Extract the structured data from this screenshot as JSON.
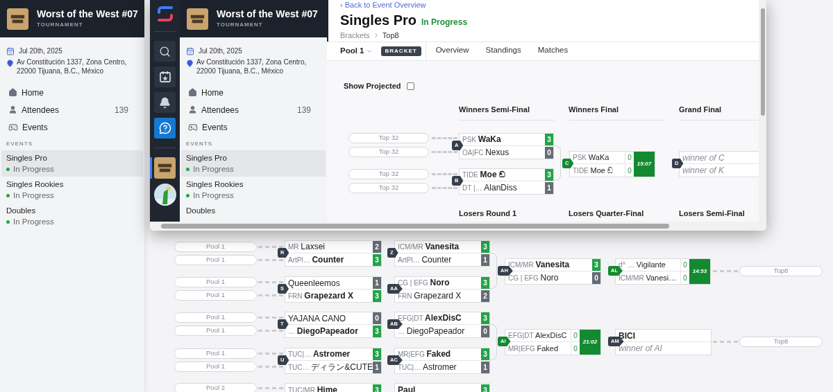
{
  "background": {
    "sidebar": {
      "title": "Worst of the West #07",
      "subtitle": "TOURNAMENT",
      "date": "Jul 20th, 2025",
      "address": "Av Constitución 1337, Zona Centro, 22000 Tijuana, B.C., México",
      "nav": [
        {
          "kind": "home",
          "label": "Home"
        },
        {
          "kind": "attendees",
          "label": "Attendees",
          "count": "139"
        },
        {
          "kind": "events",
          "label": "Events"
        }
      ],
      "events_heading": "EVENTS",
      "events": [
        {
          "name": "Singles Pro",
          "status": "In Progress",
          "selected": true
        },
        {
          "name": "Singles Rookies",
          "status": "In Progress",
          "selected": false
        },
        {
          "name": "Doubles",
          "status": "In Progress",
          "selected": false
        }
      ]
    },
    "bracket": {
      "entrants": [
        {
          "label": "Pool 1"
        },
        {
          "label": "Pool 1"
        },
        {
          "label": "Pool 1"
        },
        {
          "label": "Pool 1"
        },
        {
          "label": "Pool 1"
        },
        {
          "label": "Pool 1"
        },
        {
          "label": "Pool 1"
        },
        {
          "label": "Pool 1"
        },
        {
          "label": "Pool 2"
        }
      ],
      "matches": [
        {
          "label": "R",
          "kind": "done",
          "players": [
            {
              "prefix": "MR",
              "name": "Laxsei",
              "score": "2",
              "winner": false
            },
            {
              "prefix": "ArtPl…",
              "name": "Counter",
              "score": "3",
              "winner": true
            }
          ]
        },
        {
          "label": "S",
          "kind": "done",
          "players": [
            {
              "name": "Queenleemos",
              "score": "1",
              "winner": false
            },
            {
              "prefix": "FRN",
              "name": "Grapezard X",
              "score": "3",
              "winner": true
            }
          ]
        },
        {
          "label": "T",
          "kind": "done",
          "players": [
            {
              "name": "YAJANA CANO",
              "score": "0",
              "winner": false
            },
            {
              "prefix": "…",
              "name": "DiegoPapeador",
              "score": "3",
              "winner": true
            }
          ]
        },
        {
          "label": "U",
          "kind": "done",
          "players": [
            {
              "prefix": "TUC|…",
              "name": "Astromer",
              "score": "3",
              "winner": true
            },
            {
              "prefix": "TUC…",
              "name": "ディラン&CUTE",
              "score": "1",
              "winner": false
            }
          ]
        },
        {
          "kind": "done",
          "players": [
            {
              "prefix": "TUC/MR",
              "name": "Hime",
              "score": "3",
              "winner": true
            }
          ]
        },
        {
          "label": "Z",
          "kind": "done",
          "players": [
            {
              "prefix": "ICM/MR",
              "name": "Vanesita",
              "score": "3",
              "winner": true
            },
            {
              "prefix": "ArtPl…",
              "name": "Counter",
              "score": "1",
              "winner": false
            }
          ]
        },
        {
          "label": "AA",
          "kind": "done",
          "players": [
            {
              "prefix": "CG | EFG",
              "name": "Noro",
              "score": "3",
              "winner": true
            },
            {
              "prefix": "FRN",
              "name": "Grapezard X",
              "score": "2",
              "winner": false
            }
          ]
        },
        {
          "label": "AB",
          "kind": "done",
          "players": [
            {
              "prefix": "EFG|DT",
              "name": "AlexDisC",
              "score": "3",
              "winner": true
            },
            {
              "prefix": "…",
              "name": "DiegoPapeador",
              "score": "0",
              "winner": false
            }
          ]
        },
        {
          "label": "AC",
          "kind": "done",
          "players": [
            {
              "prefix": "MR|EFG",
              "name": "Faked",
              "score": "3",
              "winner": true
            },
            {
              "prefix": "TUC|…",
              "name": "Astromer",
              "score": "1",
              "winner": false
            }
          ]
        },
        {
          "kind": "done",
          "players": [
            {
              "name": "Paul",
              "score": "3",
              "winner": true
            }
          ]
        },
        {
          "label": "AH",
          "kind": "done",
          "players": [
            {
              "prefix": "ICM/MR",
              "name": "Vanesita",
              "score": "3",
              "winner": true
            },
            {
              "prefix": "CG | EFG",
              "name": "Noro",
              "score": "0",
              "winner": false
            }
          ]
        },
        {
          "label": "AI",
          "kind": "live",
          "timer": "21:02",
          "players": [
            {
              "prefix": "EFG|DT",
              "name": "AlexDisC",
              "score": "0",
              "winner": false
            },
            {
              "prefix": "MR|EFG",
              "name": "Faked",
              "score": "0",
              "winner": false
            }
          ]
        },
        {
          "label": "AL",
          "kind": "live",
          "timer": "14:53",
          "players": [
            {
              "prefix": "d^ …",
              "name": "Vigilante",
              "score": "0",
              "winner": false
            },
            {
              "prefix": "ICM/MR",
              "name": "Vanesi…",
              "score": "0",
              "winner": false
            }
          ]
        },
        {
          "label": "AM",
          "kind": "pending",
          "players": [
            {
              "name": "BICI",
              "tbd": false
            },
            {
              "name": "winner of AI",
              "tbd": true
            }
          ]
        }
      ],
      "outputs": [
        {
          "label": "Top8"
        },
        {
          "label": "Top8"
        }
      ]
    }
  },
  "window": {
    "rail": [
      {
        "kind": "search",
        "selected": false
      },
      {
        "kind": "calendar",
        "selected": false
      },
      {
        "kind": "bell",
        "selected": false
      },
      {
        "kind": "help",
        "selected": false
      },
      {
        "kind": "tournament",
        "selected": true
      }
    ],
    "sidebar": {
      "title": "Worst of the West #07",
      "subtitle": "TOURNAMENT",
      "date": "Jul 20th, 2025",
      "address": "Av Constitución 1337, Zona Centro, 22000 Tijuana, B.C., México",
      "nav": [
        {
          "kind": "home",
          "label": "Home"
        },
        {
          "kind": "attendees",
          "label": "Attendees",
          "count": "139"
        },
        {
          "kind": "events",
          "label": "Events"
        }
      ],
      "events_heading": "EVENTS",
      "events": [
        {
          "name": "Singles Pro",
          "status": "In Progress",
          "selected": true
        },
        {
          "name": "Singles Rookies",
          "status": "In Progress",
          "selected": false
        },
        {
          "name": "Doubles",
          "selected": false
        }
      ]
    },
    "main": {
      "back_link": "‹ Back to Event Overview",
      "title": "Singles Pro",
      "status": "In Progress",
      "breadcrumb": [
        "Brackets",
        "Top8"
      ],
      "pool": "Pool 1",
      "badge": "BRACKET",
      "tabs": [
        {
          "label": "Overview",
          "selected": false
        },
        {
          "label": "Standings",
          "selected": false
        },
        {
          "label": "Matches",
          "selected": false
        }
      ],
      "show_projected": {
        "label": "Show Projected",
        "checked": false
      },
      "rounds": [
        {
          "title": "Winners Semi-Final"
        },
        {
          "title": "Winners Final"
        },
        {
          "title": "Grand Final"
        },
        {
          "title": "Losers Round 1"
        },
        {
          "title": "Losers Quarter-Final"
        },
        {
          "title": "Losers Semi-Final"
        }
      ],
      "entrants": [
        {
          "label": "Top 32"
        },
        {
          "label": "Top 32"
        },
        {
          "label": "Top 32"
        },
        {
          "label": "Top 32"
        }
      ],
      "matches": [
        {
          "label": "A",
          "kind": "done",
          "players": [
            {
              "prefix": "PSK",
              "name": "WaKa",
              "score": "3",
              "winner": true
            },
            {
              "prefix": "OA|FC",
              "name": "Nexus",
              "score": "0",
              "winner": false
            }
          ]
        },
        {
          "label": "B",
          "kind": "done",
          "players": [
            {
              "prefix": "TIDE",
              "name": "Moe ඞ",
              "score": "3",
              "winner": true
            },
            {
              "prefix": "DT |…",
              "name": "AlanDiss",
              "score": "1",
              "winner": false
            }
          ]
        },
        {
          "label": "C",
          "kind": "live",
          "timer": "15:07",
          "players": [
            {
              "prefix": "PSK",
              "name": "WaKa",
              "score": "0",
              "winner": false
            },
            {
              "prefix": "TIDE",
              "name": "Moe ඞ",
              "score": "0",
              "winner": false
            }
          ]
        },
        {
          "label": "D",
          "kind": "pending",
          "players": [
            {
              "name": "winner of C",
              "tbd": true
            },
            {
              "name": "winner of K",
              "tbd": true
            }
          ]
        }
      ]
    }
  }
}
